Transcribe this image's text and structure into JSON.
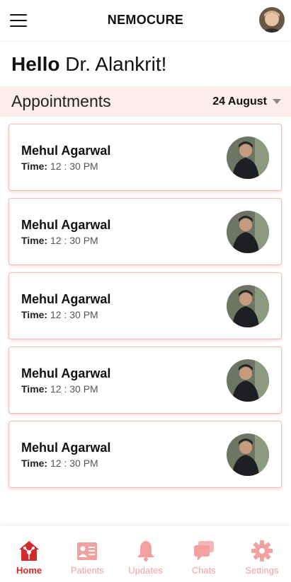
{
  "header": {
    "brand": "NEMOCURE"
  },
  "greeting": {
    "hello": "Hello",
    "name": "Dr. Alankrit!"
  },
  "appointments": {
    "title": "Appointments",
    "date": "24 August",
    "time_label": "Time:",
    "items": [
      {
        "name": "Mehul Agarwal",
        "time": "12 : 30 PM"
      },
      {
        "name": "Mehul Agarwal",
        "time": "12 : 30 PM"
      },
      {
        "name": "Mehul Agarwal",
        "time": "12 : 30 PM"
      },
      {
        "name": "Mehul Agarwal",
        "time": "12 : 30 PM"
      },
      {
        "name": "Mehul Agarwal",
        "time": "12 : 30 PM"
      }
    ]
  },
  "nav": {
    "items": [
      {
        "label": "Home",
        "icon": "home-icon",
        "active": true
      },
      {
        "label": "Patients",
        "icon": "patients-icon",
        "active": false
      },
      {
        "label": "Updates",
        "icon": "bell-icon",
        "active": false
      },
      {
        "label": "Chats",
        "icon": "chat-icon",
        "active": false
      },
      {
        "label": "Settings",
        "icon": "gear-icon",
        "active": false
      }
    ]
  },
  "colors": {
    "accent": "#d42a2a",
    "accent_light": "#f3a0a0",
    "band_bg": "#fdecec",
    "card_border": "#f2b9b9"
  }
}
